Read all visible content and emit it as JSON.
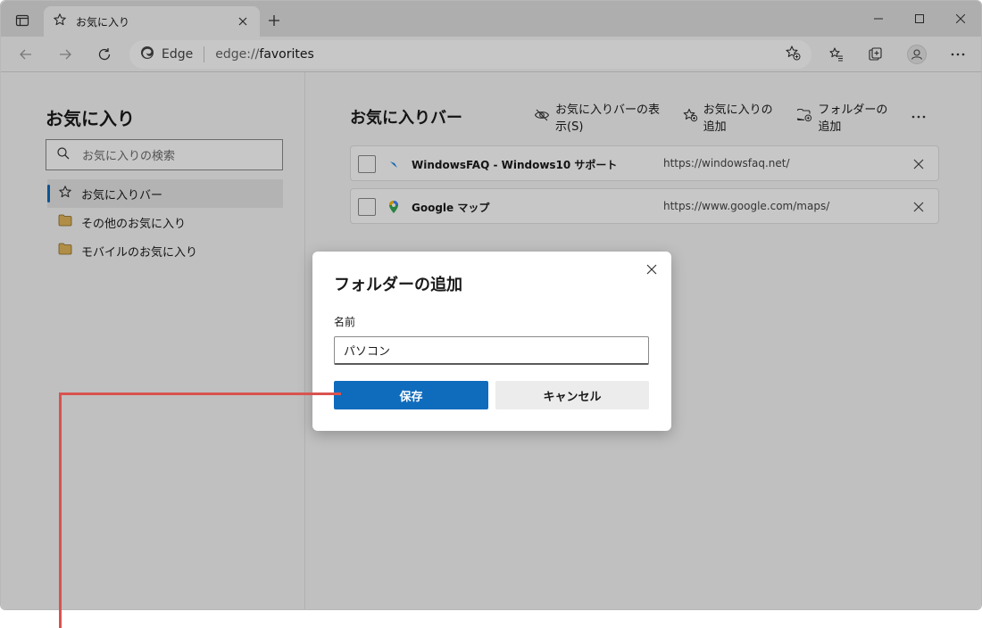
{
  "browser": {
    "tab_title": "お気に入り",
    "address_site": "Edge",
    "address_scheme": "edge://",
    "address_path": "favorites"
  },
  "sidebar": {
    "title": "お気に入り",
    "search_placeholder": "お気に入りの検索",
    "items": [
      {
        "label": "お気に入りバー",
        "icon": "star-icon",
        "active": true
      },
      {
        "label": "その他のお気に入り",
        "icon": "folder-icon",
        "active": false
      },
      {
        "label": "モバイルのお気に入り",
        "icon": "folder-icon",
        "active": false
      }
    ]
  },
  "main": {
    "title": "お気に入りバー",
    "actions": [
      {
        "label": "お気に入りバーの表示(S)",
        "icon": "eye-off-icon"
      },
      {
        "label": "お気に入りの追加",
        "icon": "star-add-icon"
      },
      {
        "label": "フォルダーの追加",
        "icon": "folder-add-icon"
      }
    ],
    "favorites": [
      {
        "name": "WindowsFAQ - Windows10  サポート",
        "url": "https://windowsfaq.net/"
      },
      {
        "name": "Google マップ",
        "url": "https://www.google.com/maps/"
      }
    ]
  },
  "dialog": {
    "title": "フォルダーの追加",
    "name_label": "名前",
    "name_value": "パソコン",
    "save_label": "保存",
    "cancel_label": "キャンセル"
  },
  "colors": {
    "accent": "#0f6cbd",
    "callout": "#d9534f"
  }
}
